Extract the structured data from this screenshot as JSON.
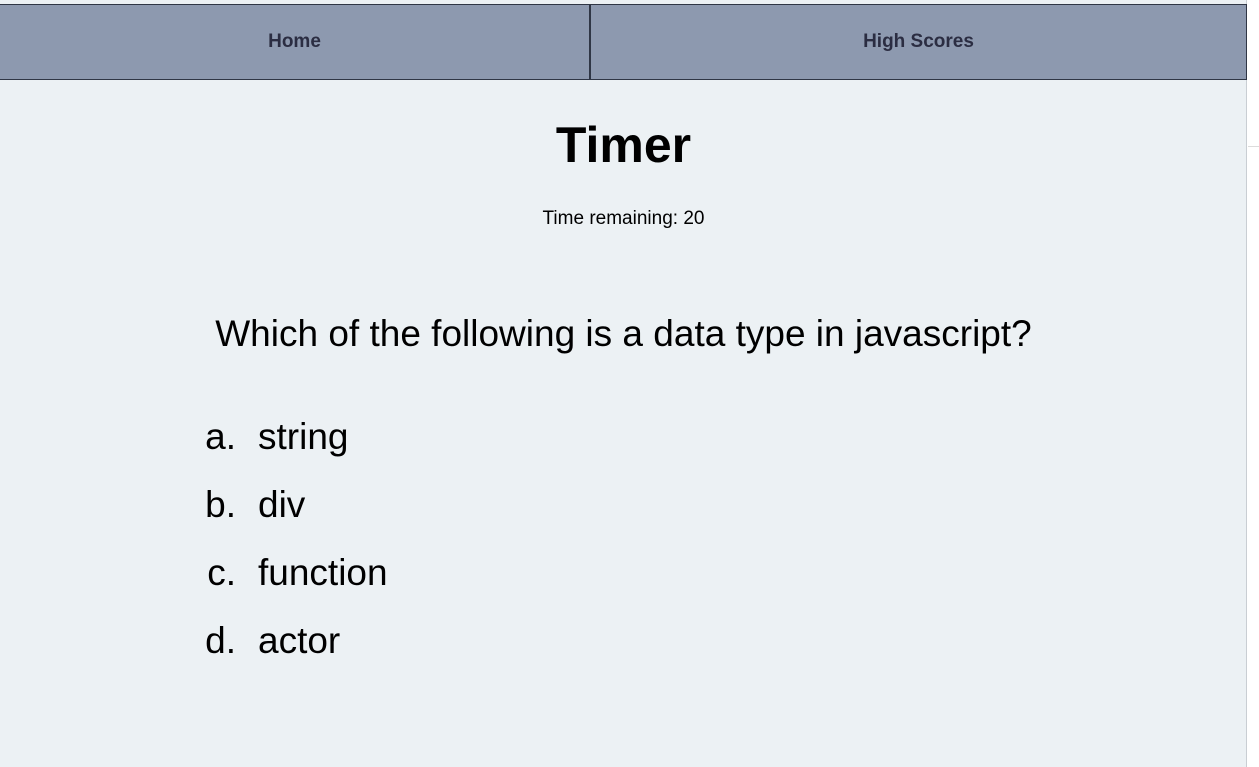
{
  "nav": {
    "home_label": "Home",
    "high_scores_label": "High Scores"
  },
  "main": {
    "title": "Timer",
    "time_remaining": "Time remaining: 20",
    "question": "Which of the following is a data type in javascript?",
    "answers": [
      {
        "marker": "a.",
        "text": "string"
      },
      {
        "marker": "b.",
        "text": "div"
      },
      {
        "marker": "c.",
        "text": "function"
      },
      {
        "marker": "d.",
        "text": "actor"
      }
    ]
  },
  "colors": {
    "navbar_bg": "#8d99af",
    "nav_text": "#2b2d42",
    "page_bg": "#ecf1f4"
  }
}
